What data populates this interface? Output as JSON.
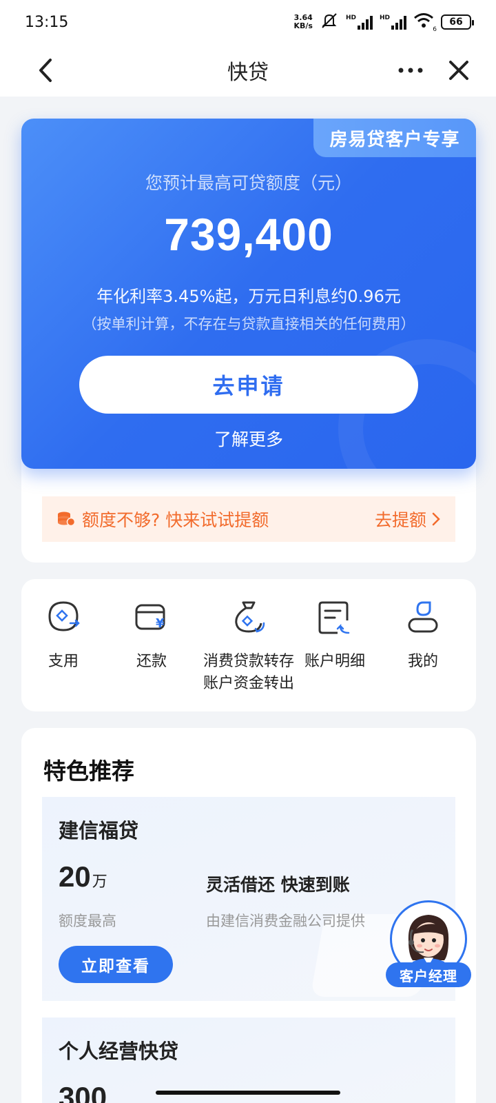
{
  "status_bar": {
    "time": "13:15",
    "net_speed_value": "3.64",
    "net_speed_unit": "KB/s",
    "signal1_label": "HD",
    "signal2_label": "HD",
    "wifi_label": "6",
    "battery": "66"
  },
  "nav": {
    "title": "快贷",
    "more_label": "•••"
  },
  "hero": {
    "badge": "房易贷客户专享",
    "amount_label": "您预计最高可贷额度（元）",
    "amount": "739,400",
    "rate_text": "年化利率3.45%起，万元日利息约0.96元",
    "note": "（按单利计算，不存在与贷款直接相关的任何费用）",
    "apply_button": "去申请",
    "learn_more": "了解更多"
  },
  "limit_banner": {
    "text": "额度不够? 快来试试提额",
    "action": "去提额"
  },
  "actions": [
    {
      "label": "支用",
      "icon": "withdraw-icon"
    },
    {
      "label": "还款",
      "icon": "repay-icon"
    },
    {
      "label": "消费贷款转存\n账户资金转出",
      "label_line1": "消费贷款转存",
      "label_line2": "账户资金转出",
      "icon": "transfer-icon"
    },
    {
      "label": "账户明细",
      "icon": "statement-icon"
    },
    {
      "label": "我的",
      "icon": "profile-icon"
    }
  ],
  "recommend": {
    "title": "特色推荐",
    "products": [
      {
        "name": "建信福贷",
        "amount": "20",
        "unit": "万",
        "amount_label": "额度最高",
        "slogan": "灵活借还 快速到账",
        "provider": "由建信消费金融公司提供",
        "button": "立即查看"
      },
      {
        "name": "个人经营快贷",
        "amount": "300"
      }
    ]
  },
  "agent": {
    "label": "客户经理"
  },
  "colors": {
    "primary": "#2f6df0",
    "orange": "#f26b2c",
    "banner_bg": "#fff1e9"
  }
}
